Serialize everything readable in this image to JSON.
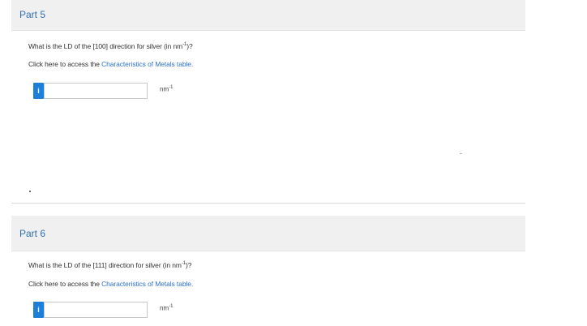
{
  "part5": {
    "title": "Part 5",
    "question_prefix": "What is the LD of the [100] direction for silver (in nm",
    "question_exp": "-1",
    "question_suffix": ")?",
    "link_prefix": "Click here to access the ",
    "link_text": "Characteristics of Metals table.",
    "info_icon": "i",
    "input_value": "",
    "unit_base": "nm",
    "unit_exp": "-1"
  },
  "part6": {
    "title": "Part 6",
    "question_prefix": "What is the LD of the [111] direction for silver (in nm",
    "question_exp": "-1",
    "question_suffix": ")?",
    "link_prefix": "Click here to access the ",
    "link_text": "Characteristics of Metals table.",
    "info_icon": "i",
    "input_value": "",
    "unit_base": "nm",
    "unit_exp": "-1"
  },
  "colors": {
    "accent": "#1e7fd8",
    "link": "#2f73c6",
    "title": "#2f6fb0",
    "header_bg": "#f0f0f0"
  },
  "icons": {
    "info_button": "info-icon"
  }
}
